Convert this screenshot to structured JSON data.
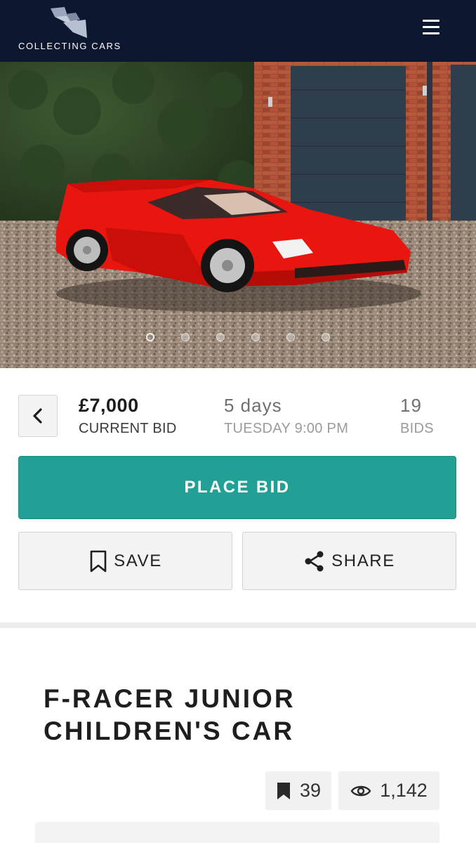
{
  "header": {
    "brand_name": "COLLECTING CARS",
    "menu_icon": "hamburger-menu-icon",
    "background_color": "#0d1730"
  },
  "gallery": {
    "image_subject": "red F-Racer junior children's car on gravel in front of brick garage",
    "slide_count": 6,
    "active_slide": 1
  },
  "bidding": {
    "back_icon": "chevron-left-icon",
    "current_bid_value": "£7,000",
    "current_bid_label": "CURRENT BID",
    "time_left_value": "5 days",
    "end_time_label": "TUESDAY 9:00 PM",
    "bid_count_value": "19",
    "bid_count_label": "BIDS",
    "place_bid_label": "PLACE BID",
    "accent_color": "#22a096"
  },
  "actions": {
    "save_label": "SAVE",
    "save_icon": "bookmark-icon",
    "share_label": "SHARE",
    "share_icon": "share-icon"
  },
  "listing": {
    "title_line1": "F-RACER JUNIOR",
    "title_line2": "CHILDREN'S CAR",
    "watch_count": "39",
    "watch_icon": "bookmark-icon",
    "view_count": "1,142",
    "view_icon": "eye-icon"
  }
}
